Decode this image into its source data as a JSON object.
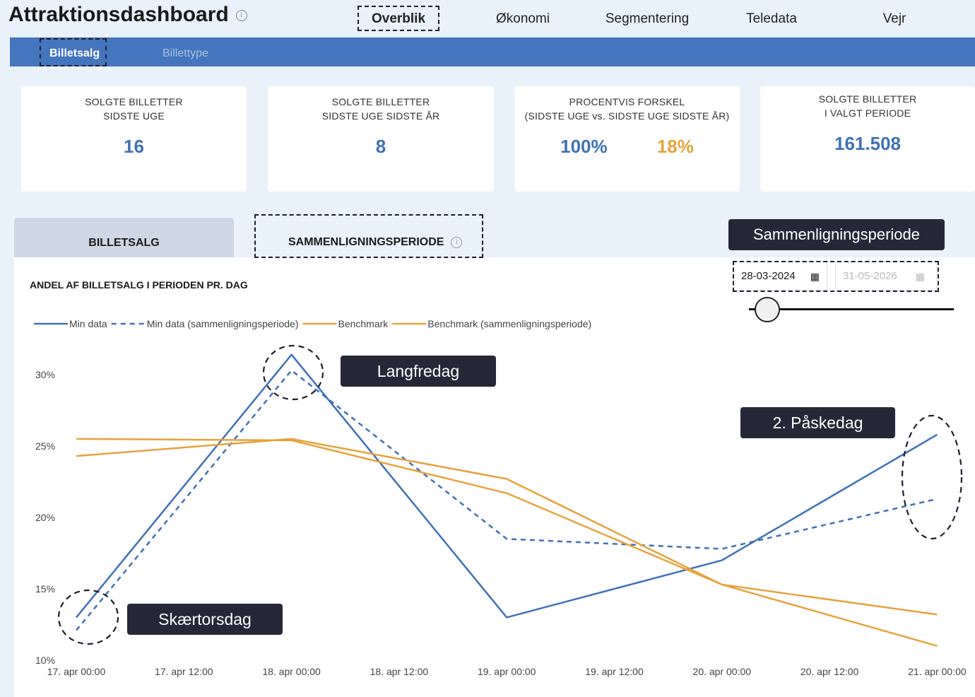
{
  "header": {
    "title": "Attraktionsdashboard",
    "info_glyph": "i",
    "tabs": [
      "Overblik",
      "Økonomi",
      "Segmentering",
      "Teledata",
      "Vejr"
    ],
    "active_tab": "Overblik"
  },
  "subnav": {
    "tabs": [
      "Billetsalg",
      "Billettype"
    ],
    "active": "Billetsalg"
  },
  "kpis": [
    {
      "label_line1": "SOLGTE BILLETTER",
      "label_line2": "SIDSTE UGE",
      "value": "16"
    },
    {
      "label_line1": "SOLGTE BILLETTER",
      "label_line2": "SIDSTE UGE SIDSTE ÅR",
      "value": "8"
    },
    {
      "label_line1": "PROCENTVIS FORSKEL",
      "label_line2": "(SIDSTE UGE vs. SIDSTE UGE SIDSTE ÅR)",
      "value_a": "100%",
      "value_b": "18%"
    },
    {
      "label_line1": "SOLGTE BILLETTER",
      "label_line2": "I VALGT PERIODE",
      "value": "161.508"
    }
  ],
  "panel": {
    "tab_billetsalg": "BILLETSALG",
    "tab_sammenligning": "SAMMENLIGNINGSPERIODE",
    "period_badge": "Sammenligningsperiode",
    "date_start": "28-03-2024",
    "date_end": "31-05-2026",
    "slider_value": 0
  },
  "annotations": {
    "langfredag": "Langfredag",
    "paaskedag": "2. Påskedag",
    "skaertorsdag": "Skærtorsdag"
  },
  "colors": {
    "blue": "#3f71b6",
    "orange": "#e7a23c",
    "bar": "#4476bd",
    "dark": "#262838"
  },
  "chart_data": {
    "type": "line",
    "title": "ANDEL AF BILLETSALG I PERIODEN PR. DAG",
    "x": [
      "17. apr 00:00",
      "18. apr 00:00",
      "19. apr 00:00",
      "20. apr 00:00",
      "21. apr 00:00"
    ],
    "x_ticks": [
      "17. apr 00:00",
      "17. apr 12:00",
      "18. apr 00:00",
      "18. apr 12:00",
      "19. apr 00:00",
      "19. apr 12:00",
      "20. apr 00:00",
      "20. apr 12:00",
      "21. apr 00:00"
    ],
    "y_ticks": [
      "10%",
      "15%",
      "20%",
      "25%",
      "30%"
    ],
    "ylim": [
      10,
      32
    ],
    "legend_position": "top-left",
    "series": [
      {
        "name": "Min data",
        "style": "solid",
        "color": "#3f71b6",
        "values": [
          13.0,
          31.4,
          13.0,
          17.0,
          25.8
        ]
      },
      {
        "name": "Min data (sammenligningsperiode)",
        "style": "dashed",
        "color": "#3f71b6",
        "values": [
          12.1,
          30.3,
          18.5,
          17.8,
          21.3
        ]
      },
      {
        "name": "Benchmark",
        "style": "solid",
        "color": "#e7a23c",
        "values": [
          25.5,
          25.4,
          21.7,
          15.3,
          11.0
        ]
      },
      {
        "name": "Benchmark (sammenligningsperiode)",
        "style": "solid",
        "color": "#e7a23c",
        "values": [
          24.3,
          25.5,
          22.7,
          15.3,
          13.2
        ]
      }
    ]
  }
}
